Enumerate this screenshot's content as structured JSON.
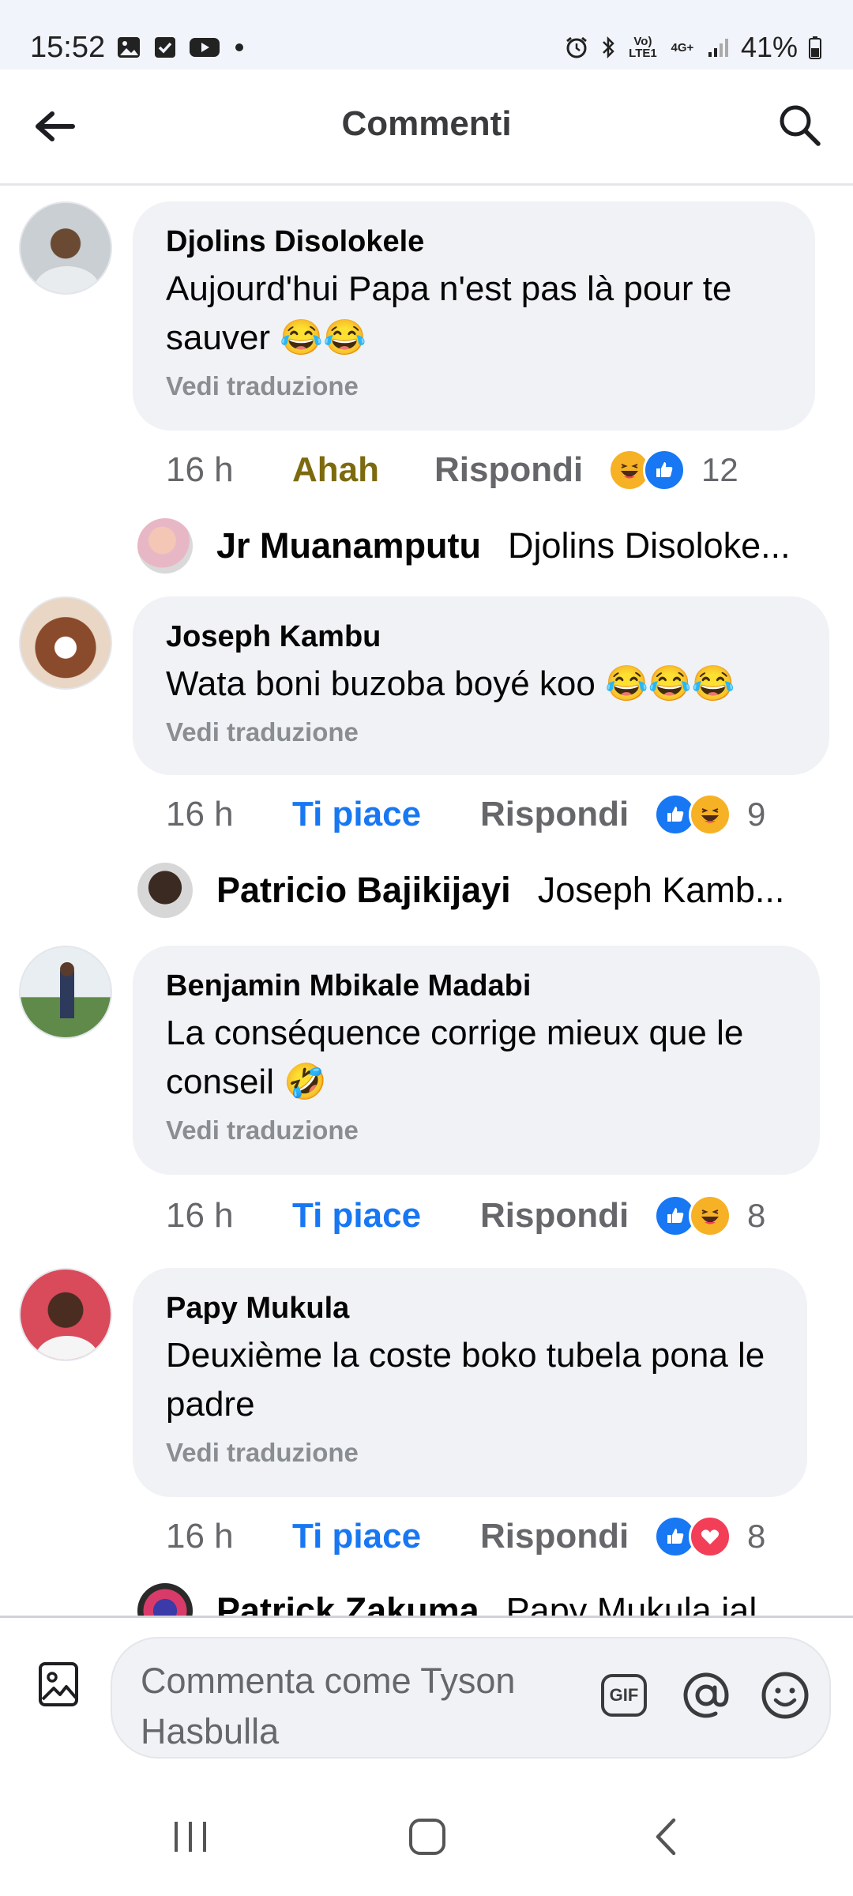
{
  "status_bar": {
    "time": "15:52",
    "battery": "41%",
    "notification_icons": [
      "gallery-icon",
      "checkbox-icon",
      "youtube-icon",
      "dot-icon"
    ],
    "system_icons": [
      "alarm-icon",
      "bluetooth-icon",
      "volte-icon",
      "4g-icon",
      "signal-icon",
      "battery-icon"
    ],
    "volte_label": "Vo) LTE1",
    "network_label": "4G+"
  },
  "header": {
    "title": "Commenti"
  },
  "comments": [
    {
      "name": "Djolins Disolokele",
      "text": "Aujourd'hui Papa n'est pas là pour te sauver 😂😂",
      "translate": "Vedi traduzione",
      "time": "16 h",
      "reaction_label": "Ahah",
      "reply_label": "Rispondi",
      "reactions": [
        "haha",
        "like"
      ],
      "count": "12",
      "reply": {
        "name": "Jr Muanamputu",
        "snippet": "Djolins Disoloke..."
      }
    },
    {
      "name": "Joseph Kambu",
      "text": "Wata boni buzoba boyé koo 😂😂😂",
      "translate": "Vedi traduzione",
      "time": "16 h",
      "reaction_label": "Ti piace",
      "reply_label": "Rispondi",
      "reactions": [
        "like",
        "haha"
      ],
      "count": "9",
      "reply": {
        "name": "Patricio Bajikijayi",
        "snippet": "Joseph Kamb..."
      }
    },
    {
      "name": "Benjamin Mbikale Madabi",
      "text": "La conséquence corrige mieux que le conseil 🤣",
      "translate": "Vedi traduzione",
      "time": "16 h",
      "reaction_label": "Ti piace",
      "reply_label": "Rispondi",
      "reactions": [
        "like",
        "haha"
      ],
      "count": "8"
    },
    {
      "name": "Papy Mukula",
      "text": "Deuxième la coste boko tubela pona le padre",
      "translate": "Vedi traduzione",
      "time": "16 h",
      "reaction_label": "Ti piace",
      "reply_label": "Rispondi",
      "reactions": [
        "like",
        "love"
      ],
      "count": "8",
      "reply": {
        "name": "Patrick Zakuma",
        "snippet": "Papy Mukula ial..."
      }
    }
  ],
  "composer": {
    "placeholder": "Commenta come Tyson Hasbulla",
    "gif_label": "GIF"
  },
  "colors": {
    "like_blue": "#1877f2",
    "haha_yellow": "#f7b125",
    "love_red": "#f33e58",
    "ahah_text": "#7d6a0f",
    "bubble_bg": "#f0f2f5"
  }
}
